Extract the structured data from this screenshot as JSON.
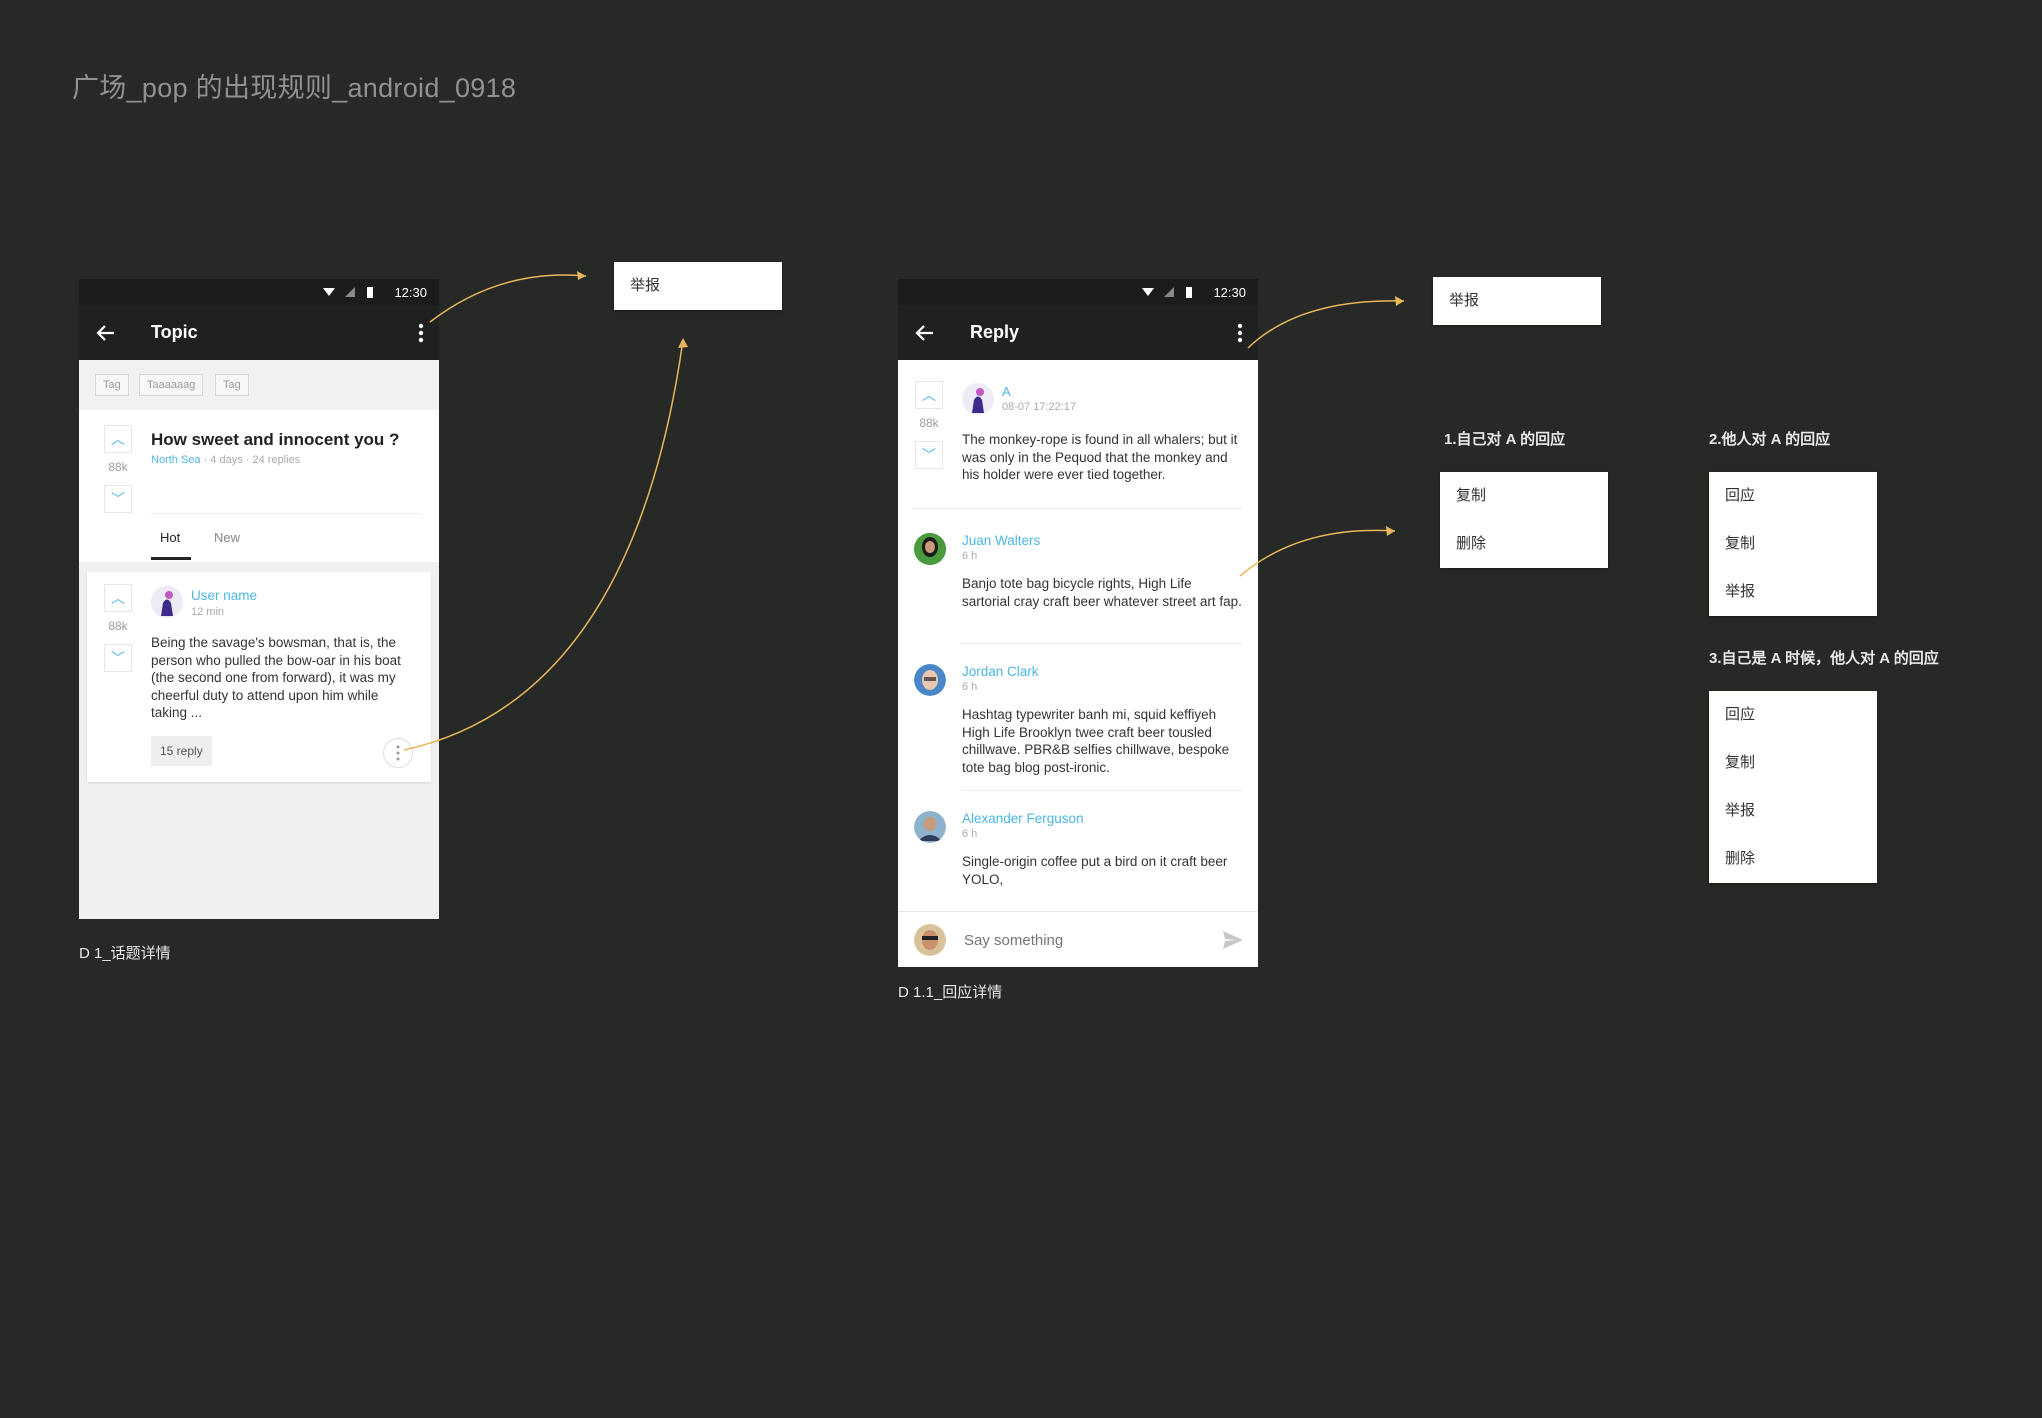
{
  "board_title": "广场_pop 的出现规则_android_0918",
  "status_time": "12:30",
  "topic_screen": {
    "app_title": "Topic",
    "tags": [
      "Tag",
      "Taaaaaag",
      "Tag"
    ],
    "vote_count": "88k",
    "post_title": "How sweet and innocent you ?",
    "post_author": "North Sea",
    "post_meta": " · 4 days · 24 replies",
    "tabs": [
      "Hot",
      "New"
    ],
    "card": {
      "vote_count": "88k",
      "username": "User name",
      "time": "12 min",
      "body": "Being the savage's bowsman, that is, the person who pulled the bow-oar in his boat (the second one from forward), it was my cheerful duty to attend upon him while taking  ...",
      "reply_chip": "15 reply"
    },
    "label": "D 1_话题详情"
  },
  "reply_screen": {
    "app_title": "Reply",
    "main": {
      "vote_count": "88k",
      "author": "A",
      "time": "08-07 17:22:17",
      "body": "The monkey-rope is found in all whalers; but it was only in the Pequod that the monkey and his holder were ever tied together."
    },
    "replies": [
      {
        "name": "Juan Walters",
        "time": "6 h",
        "body": "Banjo tote bag bicycle rights, High Life sartorial cray craft beer whatever street art fap."
      },
      {
        "name": "Jordan Clark",
        "time": "6 h",
        "body": "Hashtag typewriter banh mi, squid keffiyeh High Life Brooklyn twee craft beer tousled chillwave. PBR&B selfies chillwave, bespoke tote bag blog post-ironic."
      },
      {
        "name": "Alexander Ferguson",
        "time": "6 h",
        "body": "Single-origin coffee put a bird on it craft beer YOLO,"
      }
    ],
    "input_placeholder": "Say something",
    "label": "D 1.1_回应详情"
  },
  "popups": {
    "topic_report": "举报",
    "reply_report": "举报",
    "section1": {
      "heading": "1.自己对 A 的回应",
      "items": [
        "复制",
        "删除"
      ]
    },
    "section2": {
      "heading": "2.他人对 A 的回应",
      "items": [
        "回应",
        "复制",
        "举报"
      ]
    },
    "section3": {
      "heading": "3.自己是 A 时候，他人对 A 的回应",
      "items": [
        "回应",
        "复制",
        "举报",
        "删除"
      ]
    }
  },
  "colors": {
    "background": "#262925",
    "appbar": "#1e211f",
    "accent": "#4db6e6",
    "connector": "#e8b65b"
  },
  "icons": [
    "back-arrow-icon",
    "more-vert-icon",
    "wifi-icon",
    "signal-icon",
    "battery-icon",
    "chevron-up-icon",
    "chevron-down-icon",
    "send-icon"
  ]
}
